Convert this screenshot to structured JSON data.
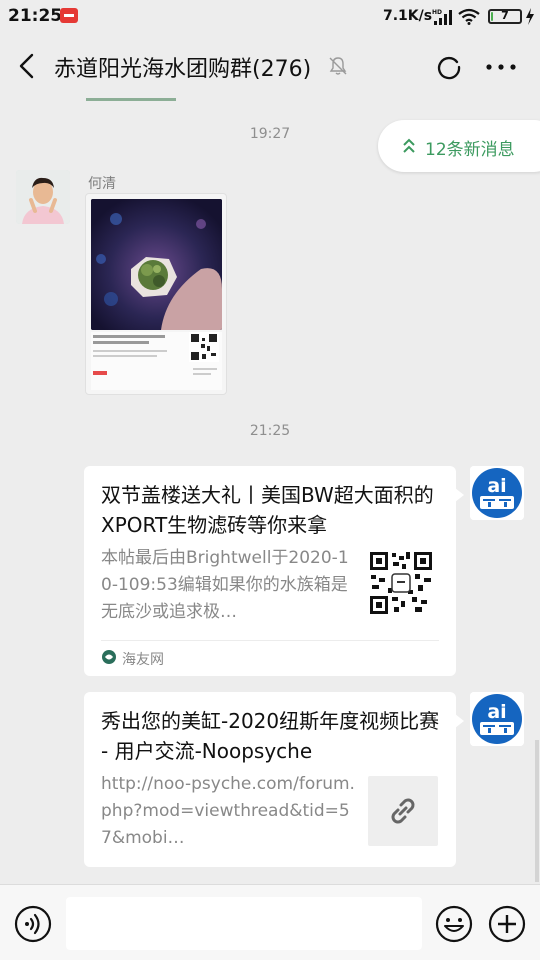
{
  "status_bar": {
    "time": "21:25",
    "net_speed": "7.1K/s",
    "battery_level": 7,
    "battery_label": "7",
    "network_badge": "HD"
  },
  "header": {
    "title": "赤道阳光海水团购群(276)"
  },
  "chat": {
    "new_messages_label": "12条新消息",
    "timestamp_1": "19:27",
    "timestamp_2": "21:25",
    "sender_name": "何清",
    "messages": [
      {
        "title": "双节盖楼送大礼丨美国BW超大面积的XPORT生物滤砖等你来拿",
        "description": "本帖最后由Brightwell于2020-10-109:53编辑如果你的水族箱是无底沙或追求极…",
        "source": "海友网"
      },
      {
        "title": "秀出您的美缸-2020纽斯年度视频比赛 - 用户交流-Noopsyche",
        "description": "http://noo-psyche.com/forum.php?mod=viewthread&tid=57&mobi…"
      }
    ]
  },
  "input": {
    "value": "",
    "placeholder": ""
  },
  "colors": {
    "accent_green": "#3c9a5f",
    "background": "#ededed",
    "bubble": "#ffffff",
    "avatar_blue": "#1565c0"
  }
}
